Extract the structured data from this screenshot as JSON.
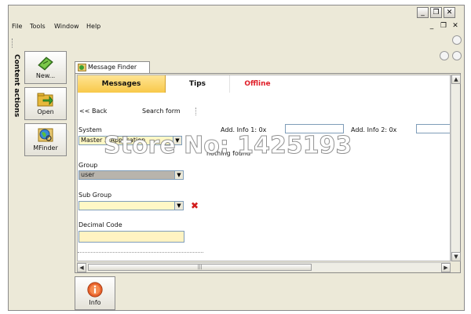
{
  "menu": {
    "items": [
      "File",
      "Tools",
      "Window",
      "Help"
    ]
  },
  "window_controls": {
    "minimize": "_",
    "restore": "❐",
    "close": "✕"
  },
  "sidebar": {
    "title": "Content actions",
    "buttons": [
      {
        "label": "New...",
        "icon": "new-document-icon"
      },
      {
        "label": "Open",
        "icon": "open-folder-icon"
      },
      {
        "label": "MFinder",
        "icon": "globe-search-icon"
      }
    ]
  },
  "document_tab": {
    "label": "Message Finder",
    "icon": "message-finder-icon"
  },
  "subtabs": [
    {
      "label": "Messages",
      "color": "#111111"
    },
    {
      "label": "Tips",
      "color": "#111111"
    },
    {
      "label": "Offline",
      "color": "#e0202a"
    }
  ],
  "nav": {
    "back": "<< Back",
    "search_form": "Search form"
  },
  "form": {
    "system_label": "System",
    "system_value": "Master 3 Application",
    "add_info_1_label": "Add. Info 1: 0x",
    "add_info_2_label": "Add. Info 2: 0x",
    "status": "nothing found",
    "group_label": "Group",
    "group_value": "user",
    "sub_group_label": "Sub Group",
    "decimal_code_label": "Decimal Code"
  },
  "footer": {
    "info_label": "Info",
    "info_icon": "info-icon"
  },
  "overlay": {
    "watermark": "Store No: 1425193"
  },
  "colors": {
    "accent_tab": "#f8c94a",
    "offline": "#e0202a",
    "input_yellow": "#fff3c2"
  }
}
